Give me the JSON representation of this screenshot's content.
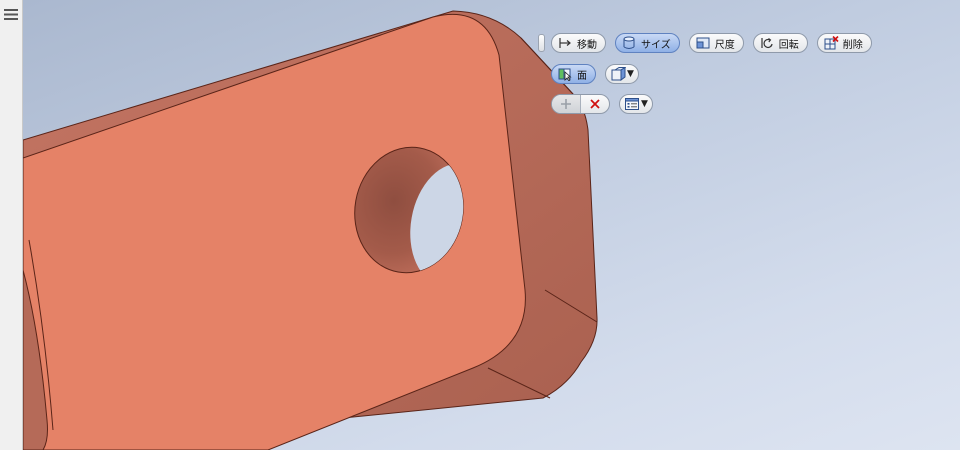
{
  "toolbar_row1": {
    "move_label": "移動",
    "size_label": "サイズ",
    "scale_label": "尺度",
    "rotate_label": "回転",
    "delete_label": "削除",
    "active_item": "size"
  },
  "toolbar_row2": {
    "face_label": "面"
  },
  "toolbar_row3": {},
  "icons": {
    "menu": "hamburger-icon",
    "move": "move-arrow-icon",
    "size": "cylinder-size-icon",
    "scale": "scale-box-icon",
    "rotate": "rotate-icon",
    "delete": "delete-grid-icon",
    "face": "face-select-icon",
    "selection_mode": "selection-mode-icon",
    "apply": "plus-icon",
    "cancel": "x-icon",
    "options": "options-list-icon"
  },
  "colors": {
    "part_face": "#e58267",
    "part_side": "#b56a58",
    "part_edge": "#5a2418",
    "viewport_top": "#aab8cf",
    "viewport_bottom": "#dde4f1",
    "active_button": "#8fb0e6",
    "cancel_red": "#d01010"
  }
}
